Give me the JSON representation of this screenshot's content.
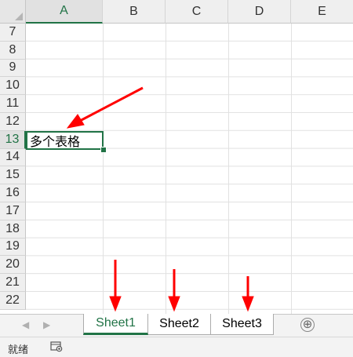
{
  "columns": [
    "A",
    "B",
    "C",
    "D",
    "E"
  ],
  "rows": [
    "7",
    "8",
    "9",
    "10",
    "11",
    "12",
    "13",
    "14",
    "15",
    "16",
    "17",
    "18",
    "19",
    "20",
    "21",
    "22"
  ],
  "active_cell": {
    "column": "A",
    "row": "13",
    "value": "多个表格"
  },
  "sheet_tabs": [
    {
      "label": "Sheet1",
      "active": true
    },
    {
      "label": "Sheet2",
      "active": false
    },
    {
      "label": "Sheet3",
      "active": false
    }
  ],
  "add_sheet_label": "⊕",
  "status": {
    "mode": "就绪"
  },
  "colors": {
    "accent": "#217346",
    "arrow": "#ff0000"
  },
  "icons": [
    "corner-select-icon",
    "scroll-left-icon",
    "scroll-right-icon",
    "add-sheet-icon",
    "macro-record-icon"
  ]
}
